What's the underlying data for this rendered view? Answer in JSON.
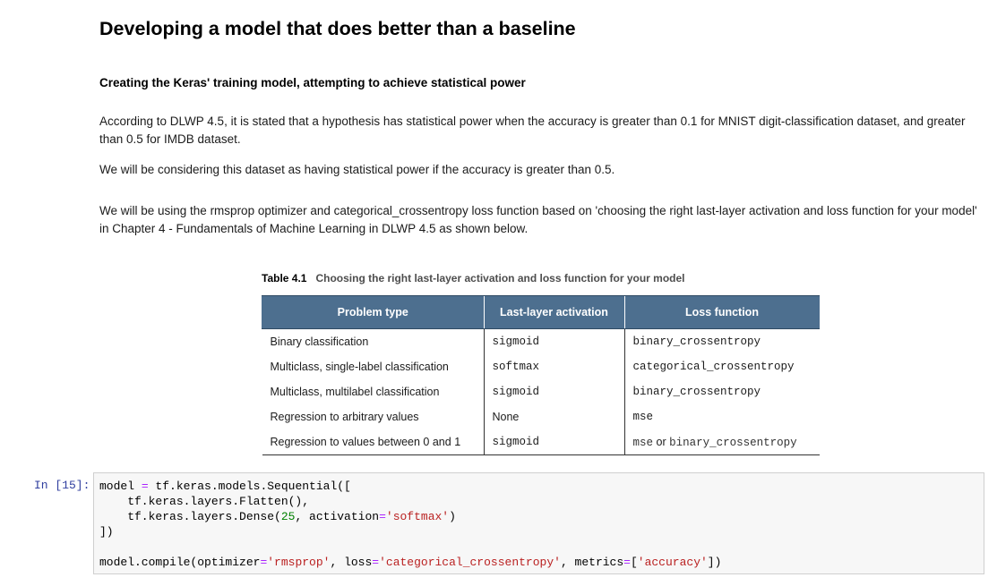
{
  "heading": "Developing a model that does better than a baseline",
  "subheading": "Creating the Keras' training model, attempting to achieve statistical power",
  "paragraphs": {
    "p1": "According to DLWP 4.5, it is stated that a hypothesis has statistical power when the accuracy is greater than 0.1 for MNIST digit-classification dataset, and greater than 0.5 for IMDB dataset.",
    "p2": "We will be considering this dataset as having statistical power if the accuracy is greater than 0.5.",
    "p3": "We will be using the rmsprop optimizer and categorical_crossentropy loss function based on 'choosing the right last-layer activation and loss function for your model' in Chapter 4 - Fundamentals of Machine Learning in DLWP 4.5 as shown below."
  },
  "table": {
    "number": "Table 4.1",
    "caption": "Choosing the right last-layer activation and loss function for your model",
    "headers": [
      "Problem type",
      "Last-layer activation",
      "Loss function"
    ],
    "rows": [
      [
        "Binary classification",
        "sigmoid",
        "binary_crossentropy",
        ""
      ],
      [
        "Multiclass, single-label classification",
        "softmax",
        "categorical_crossentropy",
        ""
      ],
      [
        "Multiclass, multilabel classification",
        "sigmoid",
        "binary_crossentropy",
        ""
      ],
      [
        "Regression to arbitrary values",
        "None",
        "mse",
        ""
      ],
      [
        "Regression to values between 0 and 1",
        "sigmoid",
        "mse",
        "binary_crossentropy"
      ]
    ],
    "or_word": "or"
  },
  "cell": {
    "prompt": "In [15]:",
    "code": {
      "l1a": "model ",
      "l1op": "=",
      "l1b": " tf.keras.models.Sequential([",
      "l2": "    tf.keras.layers.Flatten(),",
      "l3a": "    tf.keras.layers.Dense(",
      "l3num": "25",
      "l3b": ", activation",
      "l3op": "=",
      "l3str": "'softmax'",
      "l3c": ")",
      "l4": "])",
      "l6a": "model.compile(optimizer",
      "l6op1": "=",
      "l6s1": "'rmsprop'",
      "l6b": ", loss",
      "l6op2": "=",
      "l6s2": "'categorical_crossentropy'",
      "l6c": ", metrics",
      "l6op3": "=",
      "l6d": "[",
      "l6s3": "'accuracy'",
      "l6e": "])"
    }
  }
}
